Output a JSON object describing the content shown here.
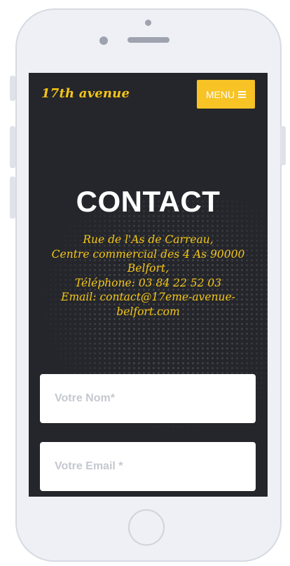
{
  "site": {
    "brand": "17th avenue",
    "menu_label": "MENU"
  },
  "hero": {
    "title": "CONTACT",
    "address_lines": [
      "Rue de l'As de Carreau,",
      "Centre commercial des 4 As 90000",
      "Belfort,",
      "Téléphone: 03 84 22 52 03",
      "Email: contact@17eme-avenue-",
      "belfort.com"
    ]
  },
  "form": {
    "name_placeholder": "Votre Nom*",
    "name_value": "",
    "email_placeholder": "Votre Email *",
    "email_value": ""
  },
  "icons": {
    "menu": "hamburger-icon"
  },
  "colors": {
    "accent": "#f7c325",
    "brand_text": "#f5c518",
    "screen_bg": "#24262b",
    "title": "#ffffff"
  }
}
